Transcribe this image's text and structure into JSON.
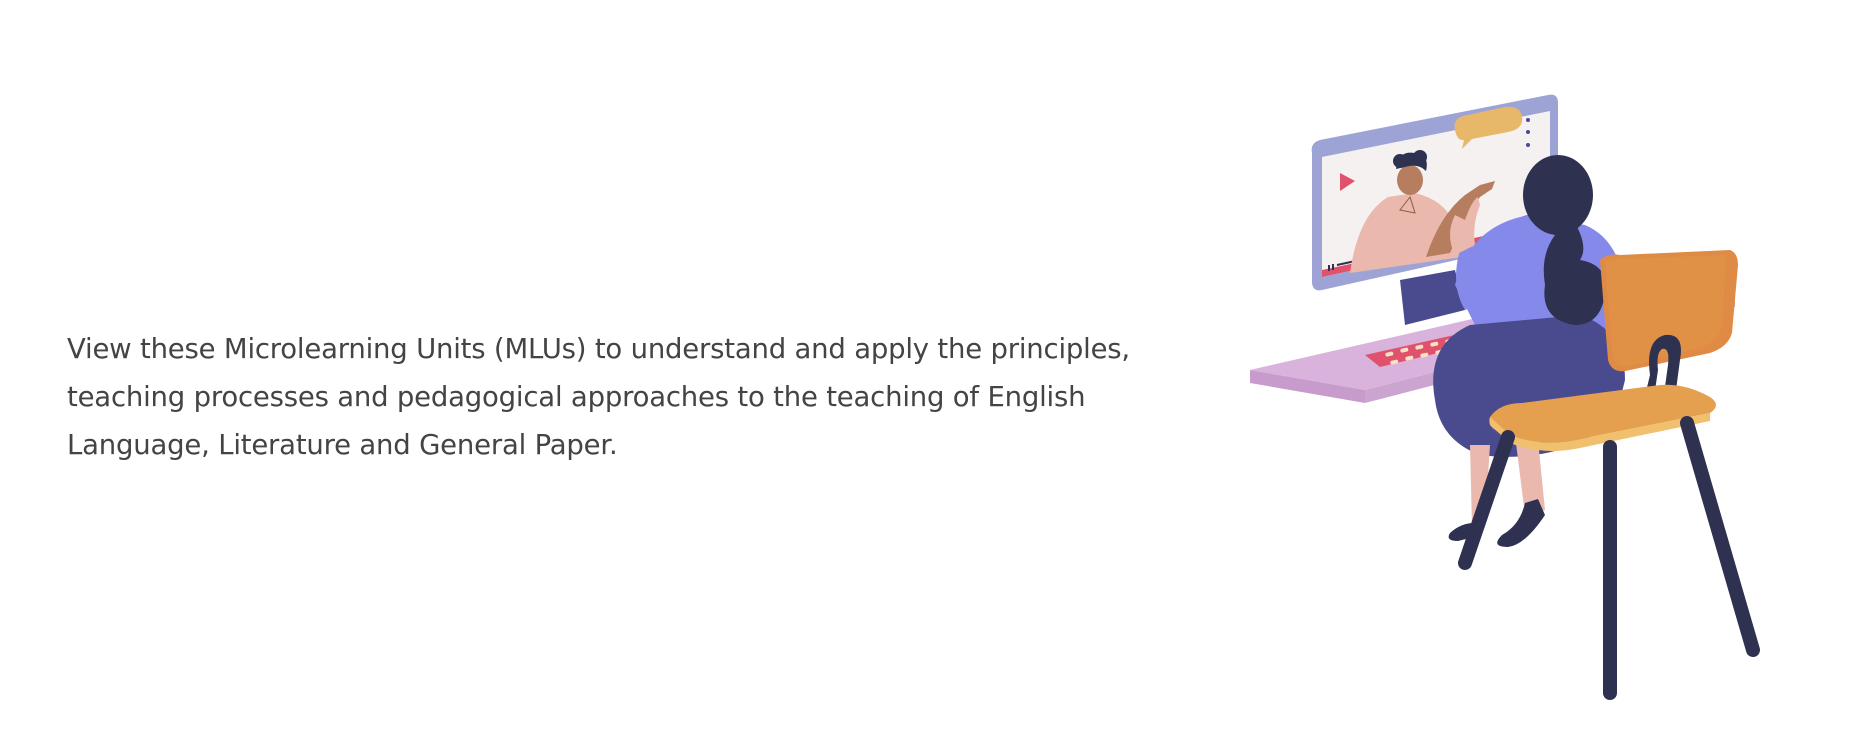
{
  "intro": {
    "text": "View these Microlearning Units (MLUs) to understand and apply the principles, teaching processes and pedagogical approaches to the teaching of English Language, Literature and General Paper."
  },
  "illustration": {
    "subject": "woman-at-computer-watching-video-lesson",
    "colors": {
      "desk": "#D9B3DC",
      "desk_shadow": "#C79BCB",
      "monitor_frame": "#9EA3D6",
      "screen_bg": "#F6F1F1",
      "speech_bubble": "#E8B86A",
      "play_icon": "#E0526B",
      "progress_bar": "#E0526B",
      "teacher_shirt": "#EBB8AE",
      "teacher_skin": "#B67E5E",
      "hair": "#2E3150",
      "woman_top": "#8489EA",
      "woman_skirt": "#4A4A8F",
      "woman_skin": "#EBB8AE",
      "chair_seat": "#E5A04F",
      "chair_back": "#DF8B45",
      "chair_legs": "#2E3150",
      "keyboard": "#E0526B"
    }
  }
}
